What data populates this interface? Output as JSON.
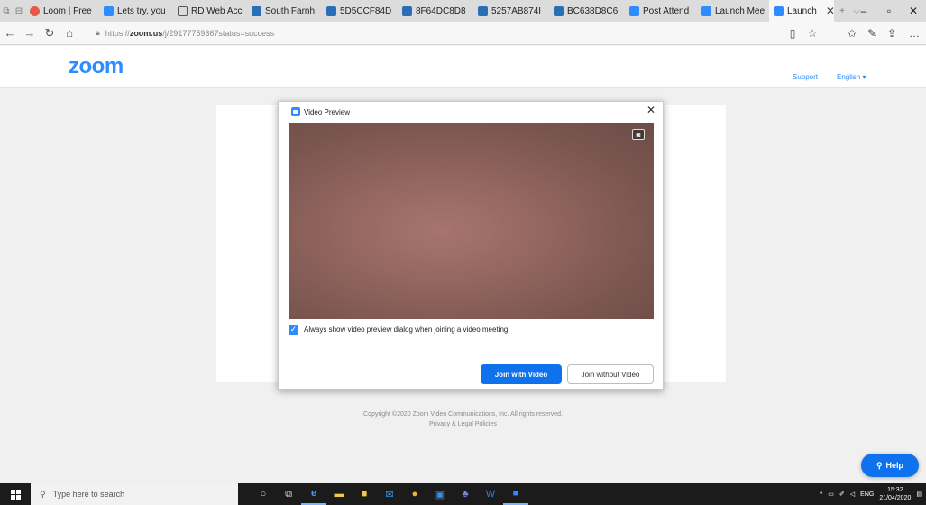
{
  "browser": {
    "tabs": [
      {
        "label": "Loom | Free",
        "color": "#e8574a"
      },
      {
        "label": "Lets try, you",
        "color": "#2d8cff"
      },
      {
        "label": "RD Web Acc",
        "color": "#555555"
      },
      {
        "label": "South Farnh",
        "color": "#2a6fb5"
      },
      {
        "label": "5D5CCF84D",
        "color": "#2a6fb5"
      },
      {
        "label": "8F64DC8D8",
        "color": "#2a6fb5"
      },
      {
        "label": "5257AB874I",
        "color": "#2a6fb5"
      },
      {
        "label": "BC638D8C6",
        "color": "#2a6fb5"
      },
      {
        "label": "Post Attend",
        "color": "#2d8cff"
      },
      {
        "label": "Launch Mee",
        "color": "#2d8cff"
      },
      {
        "label": "Launch",
        "color": "#2d8cff"
      }
    ],
    "url_prefix": "https://",
    "url_domain": "zoom.us",
    "url_path": "/j/29177759367status=success"
  },
  "zoom_header": {
    "logo": "zoom",
    "support": "Support",
    "language": "English ▾"
  },
  "dialog": {
    "title": "Video Preview",
    "checkbox_label": "Always show video preview dialog when joining a video meeting",
    "join_with_video": "Join with Video",
    "join_without_video": "Join without Video"
  },
  "footer": {
    "copyright": "Copyright ©2020 Zoom Video Communications, Inc. All rights reserved.",
    "privacy": "Privacy & Legal Policies"
  },
  "help": {
    "label": "Help"
  },
  "taskbar": {
    "search_placeholder": "Type here to search",
    "language": "ENG",
    "time": "15:32",
    "date": "21/04/2020"
  },
  "colors": {
    "zoom_blue": "#2d8cff",
    "button_blue": "#0e72ed"
  }
}
